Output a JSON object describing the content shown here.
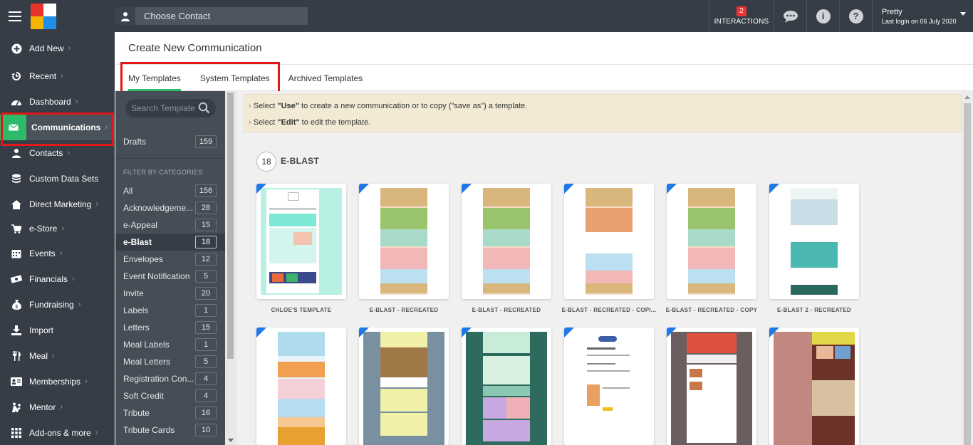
{
  "topbar": {
    "choose_contact_label": "Choose Contact",
    "interactions_count": "2",
    "interactions_label": "INTERACTIONS",
    "user_name": "Pretty",
    "last_login": "Last login on 06 July 2020"
  },
  "sidebar": {
    "items": [
      {
        "label": "Add New",
        "icon": "plus-circle-icon",
        "chevron": "›"
      },
      {
        "label": "Recent",
        "icon": "history-icon",
        "chevron": "›"
      },
      {
        "label": "Dashboard",
        "icon": "speedometer-icon",
        "chevron": "›"
      },
      {
        "label": "Communications",
        "icon": "envelope-icon",
        "chevron": "›"
      },
      {
        "label": "Contacts",
        "icon": "person-icon",
        "chevron": "›"
      },
      {
        "label": "Custom Data Sets",
        "icon": "database-icon",
        "chevron": ""
      },
      {
        "label": "Direct Marketing",
        "icon": "house-icon",
        "chevron": "›"
      },
      {
        "label": "e-Store",
        "icon": "cart-icon",
        "chevron": "›"
      },
      {
        "label": "Events",
        "icon": "calendar-icon",
        "chevron": "›"
      },
      {
        "label": "Financials",
        "icon": "money-icon",
        "chevron": "›"
      },
      {
        "label": "Fundraising",
        "icon": "money-bag-icon",
        "chevron": "›"
      },
      {
        "label": "Import",
        "icon": "import-icon",
        "chevron": ""
      },
      {
        "label": "Meal",
        "icon": "utensils-icon",
        "chevron": "›"
      },
      {
        "label": "Memberships",
        "icon": "id-card-icon",
        "chevron": "›"
      },
      {
        "label": "Mentor",
        "icon": "mentor-icon",
        "chevron": "›"
      },
      {
        "label": "Add-ons & more",
        "icon": "grid-icon",
        "chevron": "›"
      }
    ]
  },
  "page": {
    "title": "Create New Communication",
    "tabs": [
      {
        "label": "My Templates"
      },
      {
        "label": "System Templates"
      },
      {
        "label": "Archived Templates"
      }
    ]
  },
  "categories": {
    "search_placeholder": "Search Templates",
    "drafts": {
      "label": "Drafts",
      "count": "159"
    },
    "filter_label": "FILTER BY CATEGORIES",
    "items": [
      {
        "label": "All",
        "count": "156"
      },
      {
        "label": "Acknowledgeme...",
        "count": "28"
      },
      {
        "label": "e-Appeal",
        "count": "15"
      },
      {
        "label": "e-Blast",
        "count": "18"
      },
      {
        "label": "Envelopes",
        "count": "12"
      },
      {
        "label": "Event Notification",
        "count": "5"
      },
      {
        "label": "Invite",
        "count": "20"
      },
      {
        "label": "Labels",
        "count": "1"
      },
      {
        "label": "Letters",
        "count": "15"
      },
      {
        "label": "Meal Labels",
        "count": "1"
      },
      {
        "label": "Meal Letters",
        "count": "5"
      },
      {
        "label": "Registration Con...",
        "count": "4"
      },
      {
        "label": "Soft Credit",
        "count": "4"
      },
      {
        "label": "Tribute",
        "count": "16"
      },
      {
        "label": "Tribute Cards",
        "count": "10"
      }
    ]
  },
  "info": {
    "line1_pre": "Select ",
    "line1_bold": "\"Use\"",
    "line1_post": " to create a new communication or to copy (\"save as\") a template.",
    "line2_pre": "Select ",
    "line2_bold": "\"Edit\"",
    "line2_post": " to edit the template."
  },
  "section": {
    "count": "18",
    "title": "E-BLAST"
  },
  "templates": {
    "row1": [
      {
        "label": "CHLOE'S TEMPLATE"
      },
      {
        "label": "E-BLAST - RECREATED"
      },
      {
        "label": "E-BLAST - RECREATED"
      },
      {
        "label": "E-BLAST - RECREATED - COPI..."
      },
      {
        "label": "E-BLAST - RECREATED - COPY"
      },
      {
        "label": "E-BLAST 2 - RECREATED"
      }
    ]
  },
  "colors": {
    "sidebar_bg": "#363d47",
    "accent_green": "#2dbb6b",
    "highlight_red": "#e01818",
    "corner_blue": "#1f78e8"
  }
}
